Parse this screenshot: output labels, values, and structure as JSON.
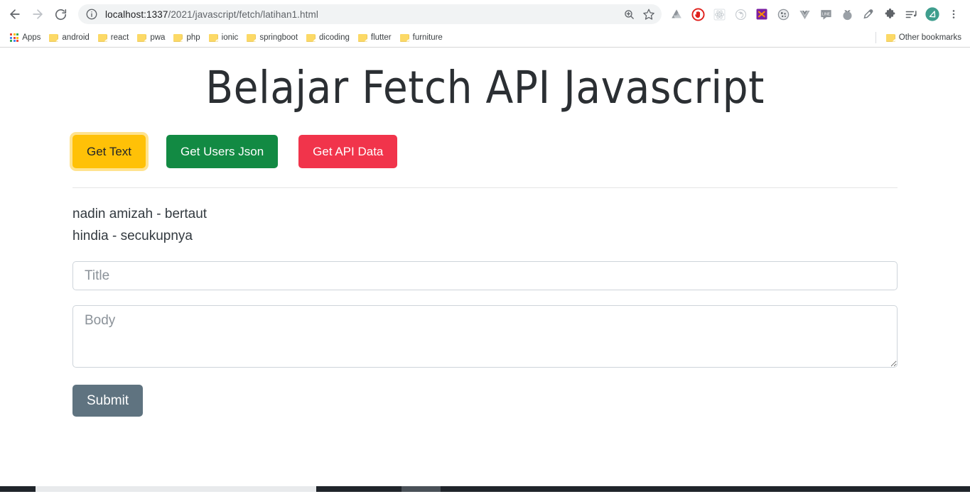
{
  "browser": {
    "nav": {
      "back_label": "Back",
      "forward_label": "Forward",
      "reload_label": "Reload"
    },
    "omnibox": {
      "info_icon": "info-icon",
      "url_host": "localhost:1337",
      "url_path": "/2021/javascript/fetch/latihan1.html",
      "url_full": "localhost:1337/2021/javascript/fetch/latihan1.html",
      "zoom_icon": "zoom-search-icon",
      "bookmark_icon": "star-icon"
    },
    "extensions": [
      {
        "name": "google-drive-icon",
        "color": "#9aa0a6"
      },
      {
        "name": "adblock-stop-hand-icon",
        "color": "#e0201b"
      },
      {
        "name": "react-devtools-icon",
        "color": "#c8cdd2"
      },
      {
        "name": "redux-devtools-icon",
        "color": "#c8cdd2"
      },
      {
        "name": "colorzilla-icon",
        "color": "#7b1fa2"
      },
      {
        "name": "wappalyzer-icon",
        "color": "#8e949a"
      },
      {
        "name": "vue-devtools-icon",
        "color": "#9aa0a6"
      },
      {
        "name": "line-messenger-icon",
        "color": "#8e949a"
      },
      {
        "name": "tomato-timer-icon",
        "color": "#8e949a"
      },
      {
        "name": "eyedropper-icon",
        "color": "#7c8288"
      },
      {
        "name": "extensions-puzzle-icon",
        "color": "#5f6368"
      },
      {
        "name": "playlist-queue-icon",
        "color": "#5f6368"
      }
    ],
    "profile": {
      "name": "profile-avatar",
      "color": "#3f9e8e"
    },
    "menu": {
      "name": "chrome-menu-icon",
      "label": "Customize and control Google Chrome"
    },
    "bookmarks": {
      "apps_label": "Apps",
      "items": [
        {
          "label": "android"
        },
        {
          "label": "react"
        },
        {
          "label": "pwa"
        },
        {
          "label": "php"
        },
        {
          "label": "ionic"
        },
        {
          "label": "springboot"
        },
        {
          "label": "dicoding"
        },
        {
          "label": "flutter"
        },
        {
          "label": "furniture"
        }
      ],
      "other_label": "Other bookmarks"
    }
  },
  "page": {
    "title": "Belajar Fetch API Javascript",
    "buttons": [
      {
        "id": "get-text",
        "label": "Get Text",
        "bg": "#ffc107",
        "fg": "#212529",
        "focused": true
      },
      {
        "id": "get-users",
        "label": "Get Users Json",
        "bg": "#128a43",
        "fg": "#ffffff",
        "focused": false
      },
      {
        "id": "get-api",
        "label": "Get API Data",
        "bg": "#f1344b",
        "fg": "#ffffff",
        "focused": false
      }
    ],
    "output_lines": [
      "nadin amizah - bertaut",
      "hindia - secukupnya"
    ],
    "form": {
      "title_placeholder": "Title",
      "title_value": "",
      "body_placeholder": "Body",
      "body_value": "",
      "submit_label": "Submit",
      "submit_bg": "#5f7380"
    }
  }
}
